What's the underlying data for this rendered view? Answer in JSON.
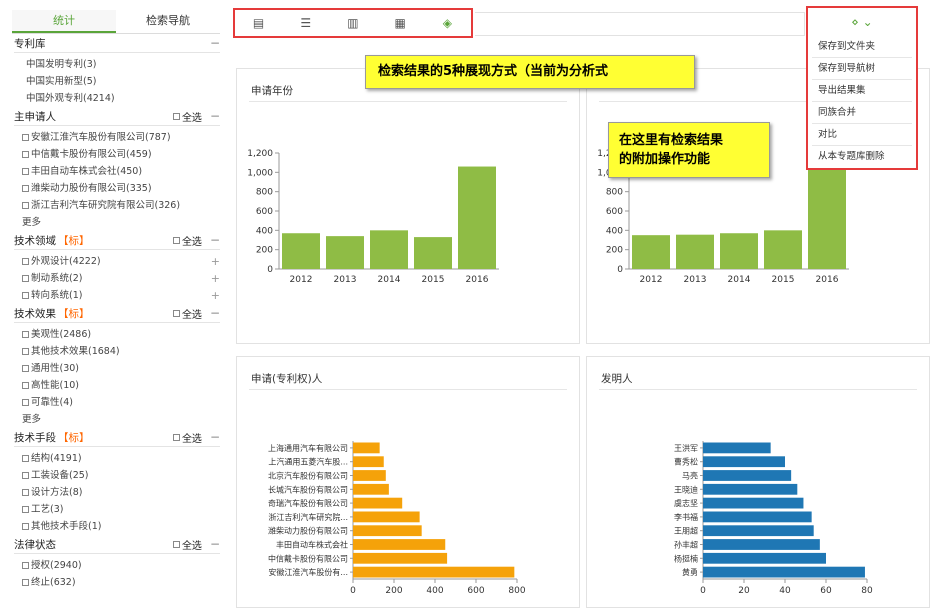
{
  "sidebar": {
    "tabs": [
      {
        "label": "统计",
        "active": true
      },
      {
        "label": "检索导航",
        "active": false
      }
    ],
    "select_all": "全选",
    "more": "更多",
    "groups": [
      {
        "title": "专利库",
        "tag": "",
        "has_select_all": false,
        "checkbox": false,
        "items": [
          {
            "label": "中国发明专利(3)"
          },
          {
            "label": "中国实用新型(5)"
          },
          {
            "label": "中国外观专利(4214)"
          }
        ],
        "more": false
      },
      {
        "title": "主申请人",
        "tag": "",
        "has_select_all": true,
        "checkbox": true,
        "items": [
          {
            "label": "安徽江淮汽车股份有限公司(787)"
          },
          {
            "label": "中信戴卡股份有限公司(459)"
          },
          {
            "label": "丰田自动车株式会社(450)"
          },
          {
            "label": "潍柴动力股份有限公司(335)"
          },
          {
            "label": "浙江吉利汽车研究院有限公司(326)"
          }
        ],
        "more": true
      },
      {
        "title": "技术领域",
        "tag": "【标】",
        "has_select_all": true,
        "checkbox": true,
        "items": [
          {
            "label": "外观设计(4222)",
            "expand": true
          },
          {
            "label": "制动系统(2)",
            "expand": true
          },
          {
            "label": "转向系统(1)",
            "expand": true
          }
        ],
        "more": false
      },
      {
        "title": "技术效果",
        "tag": "【标】",
        "has_select_all": true,
        "checkbox": true,
        "items": [
          {
            "label": "美观性(2486)"
          },
          {
            "label": "其他技术效果(1684)"
          },
          {
            "label": "通用性(30)"
          },
          {
            "label": "高性能(10)"
          },
          {
            "label": "可靠性(4)"
          }
        ],
        "more": true
      },
      {
        "title": "技术手段",
        "tag": "【标】",
        "has_select_all": true,
        "checkbox": true,
        "items": [
          {
            "label": "结构(4191)"
          },
          {
            "label": "工装设备(25)"
          },
          {
            "label": "设计方法(8)"
          },
          {
            "label": "工艺(3)"
          },
          {
            "label": "其他技术手段(1)"
          }
        ],
        "more": false
      },
      {
        "title": "法律状态",
        "tag": "",
        "has_select_all": true,
        "checkbox": true,
        "items": [
          {
            "label": "授权(2940)"
          },
          {
            "label": "终止(632)"
          }
        ],
        "more": false
      }
    ]
  },
  "toolbar": {
    "views": [
      {
        "icon": "list-detail-icon",
        "glyph": "▤",
        "active": false
      },
      {
        "icon": "list-icon",
        "glyph": "☰",
        "active": false
      },
      {
        "icon": "column-view-icon",
        "glyph": "▥",
        "active": false
      },
      {
        "icon": "grid-view-icon",
        "glyph": "▦",
        "active": false
      },
      {
        "icon": "analysis-view-icon",
        "glyph": "◈",
        "active": true
      }
    ]
  },
  "callouts": {
    "views_note": "检索结果的5种展现方式（当前为分析式",
    "ops_note_line1": "在这里有检索结果",
    "ops_note_line2": "的附加操作功能"
  },
  "dropdown": {
    "trigger_icon": "share-icon",
    "trigger_glyph": "⋄ ⌄",
    "right_icon_glyph": "▣",
    "items": [
      "保存到文件夹",
      "保存到导航树",
      "导出结果集",
      "同族合并",
      "对比",
      "从本专题库删除"
    ]
  },
  "colors": {
    "accent": "#5aa53a",
    "bar_green": "#8fbc45",
    "bar_orange": "#f5a20a",
    "bar_blue": "#1f77b4",
    "highlight_border": "#e53a3a",
    "callout_bg": "#ffff33"
  },
  "chart_data": [
    {
      "type": "bar",
      "title": "申请年份",
      "categories": [
        "2012",
        "2013",
        "2014",
        "2015",
        "2016"
      ],
      "values": [
        370,
        340,
        400,
        330,
        1060
      ],
      "ylim": [
        0,
        1200
      ],
      "yticks": [
        0,
        200,
        400,
        600,
        800,
        "1,000",
        "1,200"
      ],
      "grid": false
    },
    {
      "type": "bar",
      "title": "",
      "categories": [
        "2012",
        "2013",
        "2014",
        "2015",
        "2016"
      ],
      "values": [
        350,
        355,
        370,
        400,
        1080
      ],
      "ylim": [
        0,
        1200
      ],
      "yticks": [
        0,
        200,
        400,
        600,
        800,
        "1,000",
        "1,200"
      ],
      "grid": false
    },
    {
      "type": "bar",
      "orientation": "horizontal",
      "title": "申请(专利权)人",
      "categories": [
        "上海通用汽车有限公司",
        "上汽通用五菱汽车股...",
        "北京汽车股份有限公司",
        "长城汽车股份有限公司",
        "奇瑞汽车股份有限公司",
        "浙江吉利汽车研究院...",
        "潍柴动力股份有限公司",
        "丰田自动车株式会社",
        "中信戴卡股份有限公司",
        "安徽江淮汽车股份有..."
      ],
      "values": [
        130,
        150,
        160,
        175,
        240,
        325,
        335,
        450,
        459,
        787
      ],
      "xlim": [
        0,
        800
      ],
      "xticks": [
        0,
        200,
        400,
        600,
        800
      ]
    },
    {
      "type": "bar",
      "orientation": "horizontal",
      "title": "发明人",
      "categories": [
        "王洪军",
        "曹秀松",
        "马亮",
        "王晓迪",
        "虞志坚",
        "李书福",
        "王朋超",
        "孙丰超",
        "杨挺楠",
        "黄勇"
      ],
      "values": [
        33,
        40,
        43,
        46,
        49,
        53,
        54,
        57,
        60,
        79
      ],
      "xlim": [
        0,
        80
      ],
      "xticks": [
        0,
        20,
        40,
        60,
        80
      ]
    }
  ]
}
